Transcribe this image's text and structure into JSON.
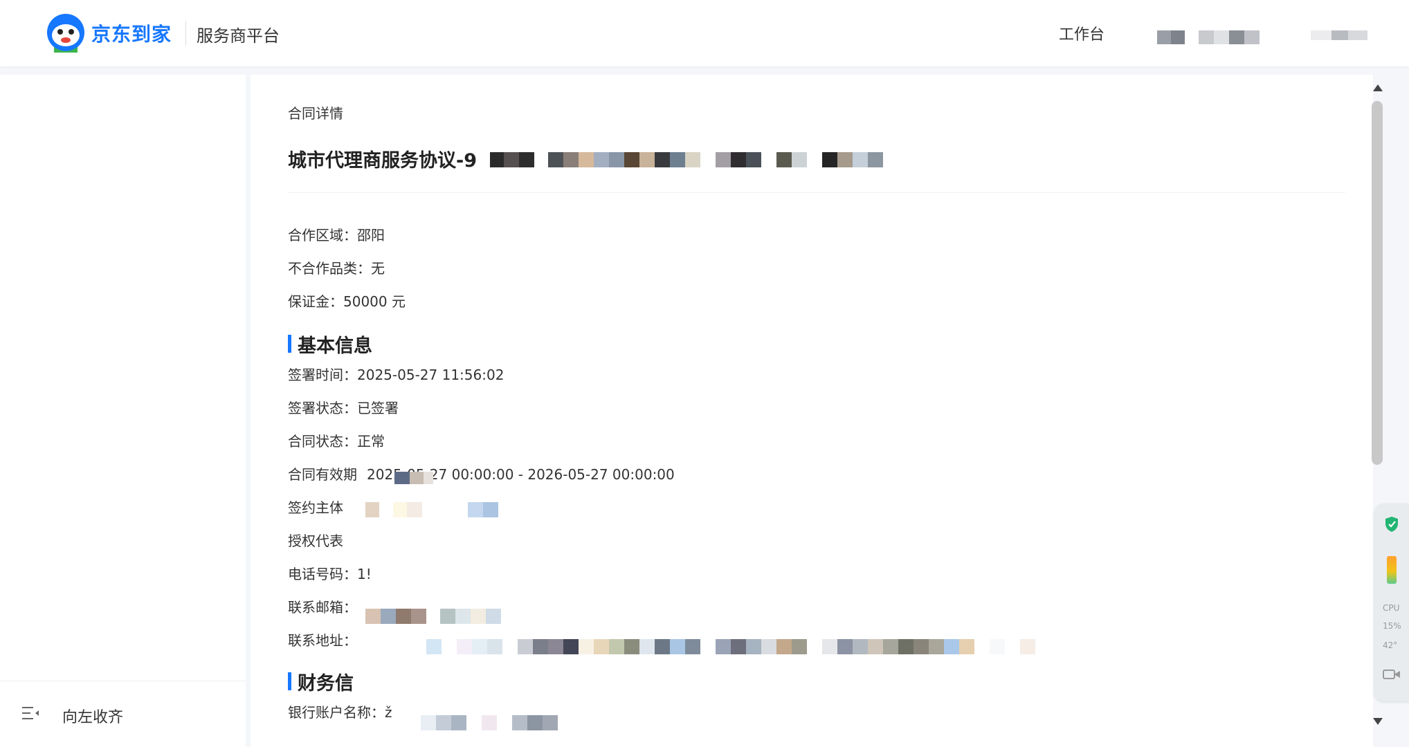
{
  "header": {
    "brand": "京东到家",
    "platform": "服务商平台",
    "workbench": "工作台"
  },
  "sidebar": {
    "collapse_label": "向左收齐"
  },
  "main": {
    "breadcrumb": "合同详情",
    "contract_title": "城市代理商服务协议-9",
    "summary": [
      {
        "label": "合作区域：",
        "value": "邵阳"
      },
      {
        "label": "不合作品类：",
        "value": "无"
      },
      {
        "label": "保证金：",
        "value": "50000 元"
      }
    ],
    "basic_section": {
      "title": "基本信息",
      "rows": [
        {
          "label": "签署时间：",
          "value": "2025-05-27 11:56:02"
        },
        {
          "label": "签署状态：",
          "value": "已签署"
        },
        {
          "label": "合同状态：",
          "value": "正常"
        },
        {
          "label": "合同有效期",
          "value": "2025-05-27 00:00:00 - 2026-05-27 00:00:00"
        },
        {
          "label": "签约主体",
          "value": ""
        },
        {
          "label": "授权代表",
          "value": ""
        },
        {
          "label": "电话号码：",
          "value": "1!"
        },
        {
          "label": "联系邮箱：",
          "value": ""
        },
        {
          "label": "联系地址：",
          "value": ""
        }
      ]
    },
    "finance_section": {
      "title": "财务信",
      "rows": [
        {
          "label": "银行账户名称：",
          "value": "ž"
        }
      ]
    }
  },
  "monitor": {
    "cpu_label": "CPU",
    "cpu_value": "15%",
    "temp_value": "42°"
  },
  "colors": {
    "accent": "#1677ff",
    "page_bg": "#f4f6fa"
  }
}
